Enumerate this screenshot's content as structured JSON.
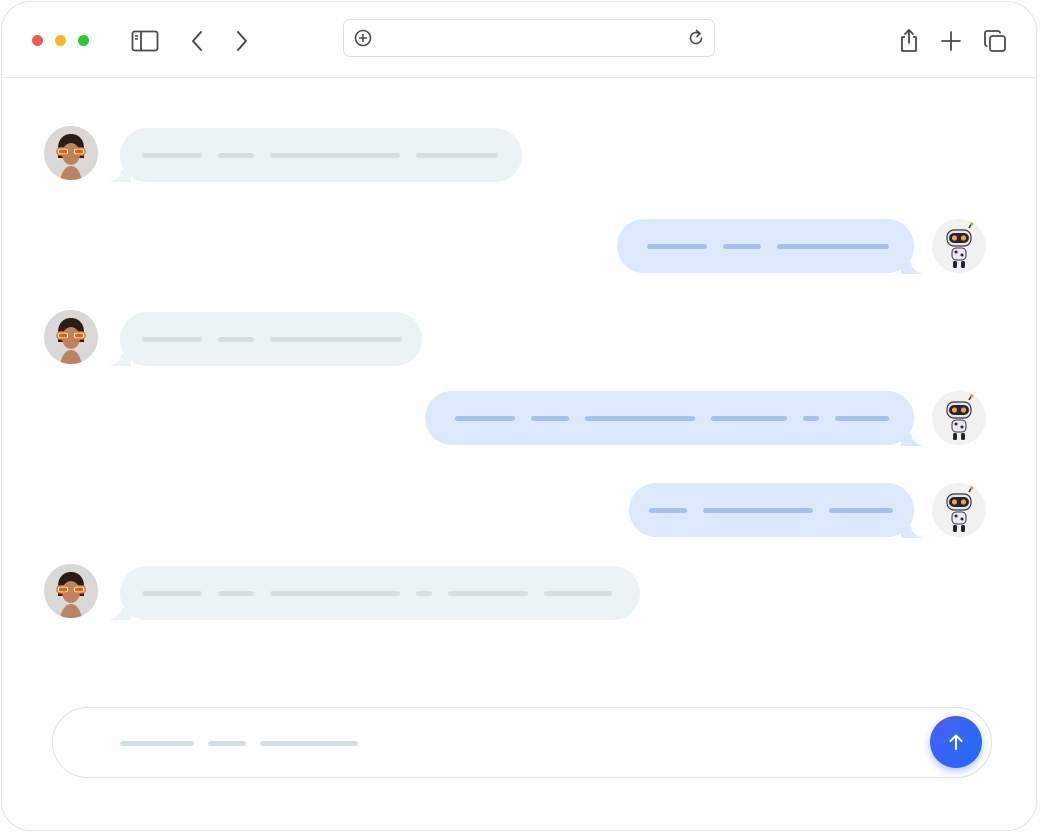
{
  "toolbar": {
    "traffic_lights": {
      "close": "#ee5a52",
      "minimize": "#f5b630",
      "zoom": "#2fc53f"
    },
    "icons": [
      "sidebar-icon",
      "back-icon",
      "forward-icon",
      "share-icon",
      "new-tab-icon",
      "tabs-icon"
    ],
    "url": {
      "value": "",
      "lead_icon": "add-circle-icon",
      "trail_icon": "reload-icon"
    }
  },
  "colors": {
    "incoming_bubble": "#ecf3f5",
    "outgoing_bubble": "#dce8fc",
    "incoming_text_placeholder": "#d4dfe3",
    "outgoing_text_placeholder": "#a9c0ea",
    "send_button": "#2f66f2"
  },
  "messages": [
    {
      "sender": "user",
      "avatar": "woman-with-sunglasses-avatar",
      "text_lines": 4
    },
    {
      "sender": "bot",
      "avatar": "robot-avatar",
      "text_lines": 3
    },
    {
      "sender": "user",
      "avatar": "woman-with-sunglasses-avatar",
      "text_lines": 3
    },
    {
      "sender": "bot",
      "avatar": "robot-avatar",
      "text_lines": 6
    },
    {
      "sender": "bot",
      "avatar": "robot-avatar",
      "text_lines": 3
    },
    {
      "sender": "user",
      "avatar": "woman-with-sunglasses-avatar",
      "text_lines": 6
    }
  ],
  "composer": {
    "value": "",
    "send_icon": "arrow-up-icon"
  }
}
